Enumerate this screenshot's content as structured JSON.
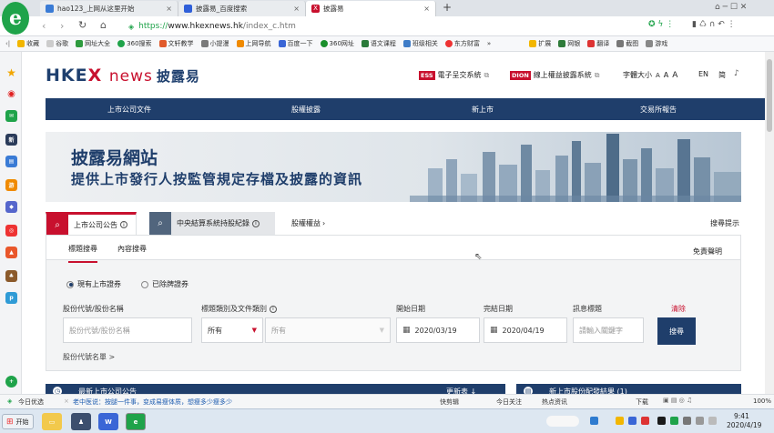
{
  "browser": {
    "tabs": [
      {
        "label": "hao123_上网从这里开始",
        "active": false
      },
      {
        "label": "披露易_百度搜索",
        "active": false
      },
      {
        "label": "披露易",
        "active": true
      }
    ],
    "new_tab": "+",
    "url": "https://www.hkexnews.hk/index_c.htm",
    "url_scheme": "https://",
    "url_host": "www.hkexnews.hk",
    "url_path": "/index_c.htm",
    "bookmarks": [
      "收藏",
      "谷歌",
      "网址大全",
      "360搜索",
      "文轩教学",
      "小提漫",
      "上网导航",
      "百度一下",
      "360网址",
      "语文课程",
      "班级相关",
      "东方财富"
    ],
    "bookmarks_right": [
      "扩展",
      "网银",
      "翻译",
      "截图",
      "游戏"
    ],
    "more": "»"
  },
  "site": {
    "logo_hkex": "HKE",
    "logo_x": "X",
    "logo_news": "news",
    "logo_zh": "披露易",
    "ess_badge": "ESS",
    "ess_label": "電子呈交系統",
    "dion_badge": "DION",
    "dion_label": "線上權益披露系統",
    "font_size_label": "字體大小",
    "font_sizes": [
      "A",
      "A",
      "A"
    ],
    "lang_en": "EN",
    "lang_sc": "简",
    "nav": [
      "上市公司文件",
      "股權披露",
      "新上市",
      "交易所報告"
    ],
    "banner_title": "披露易網站",
    "banner_subtitle": "提供上市發行人按監管規定存檔及披露的資訊"
  },
  "search": {
    "tab_listed": "上市公司公告",
    "tab_ccass": "中央結算系統持股紀錄",
    "tab_shareholding": "股權權益",
    "search_tips": "搜尋提示",
    "sub_tabs": [
      "標題搜尋",
      "內容搜尋"
    ],
    "disclaimer": "免責聲明",
    "radio_current": "現有上市證券",
    "radio_delisted": "已除牌證券",
    "label_stock": "股份代號/股份名稱",
    "label_type": "標題類別及文件類別",
    "label_from": "開始日期",
    "label_to": "完結日期",
    "label_headline": "訊息標題",
    "clear": "清除",
    "stock_placeholder": "股份代號/股份名稱",
    "type_value": "所有",
    "doc_type_value": "所有",
    "date_from": "2020/03/19",
    "date_to": "2020/04/19",
    "headline_placeholder": "請輸入關鍵字",
    "search_btn": "搜尋",
    "stock_list": "股份代號名單 >",
    "card_left": "最新上市公司公告",
    "card_left_more": "更新表 ↓",
    "card_right": "新上市股份配發結果 (1)"
  },
  "status": {
    "today": "今日优选",
    "news": "老中医说：按腿一件事，变成易瘦体质，想瘦多少瘦多少",
    "right": [
      "快剪辑",
      "今日关注",
      "热点资讯",
      "下载"
    ],
    "zoom": "100%"
  },
  "taskbar": {
    "start": "开始",
    "time": "9:41",
    "date": "2020/4/19"
  },
  "colors": {
    "navy": "#1f3e6b",
    "red": "#c8102e"
  }
}
